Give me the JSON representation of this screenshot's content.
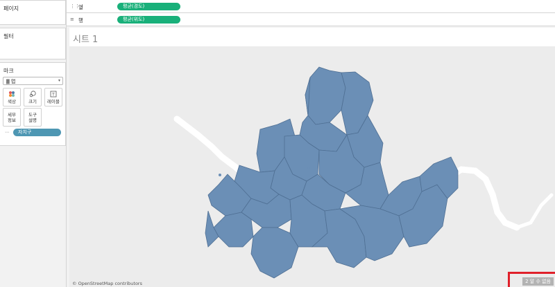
{
  "left_panel": {
    "pages_title": "페이지",
    "filters_title": "필터",
    "marks_title": "마크",
    "mark_type": "맵",
    "mark_buttons": {
      "color": "색상",
      "size": "크기",
      "label": "레이블",
      "detail": "세부\n정보",
      "tooltip": "도구\n설명"
    },
    "detail_field": "자치구"
  },
  "shelves": {
    "columns_label": "열",
    "columns_pill": "평균(경도)",
    "rows_label": "행",
    "rows_pill": "평균(위도)"
  },
  "sheet": {
    "title": "시트 1",
    "attribution": "© OpenStreetMap contributors",
    "nulls_indicator": "2 알 수 없음"
  },
  "colors": {
    "district_fill": "#6b8fb6",
    "district_stroke": "#4f6f93",
    "river": "#ffffff",
    "map_bg": "#ececec",
    "columns_pill": "#19b07a",
    "field_pill": "#4e97b3",
    "highlight": "#e0202a"
  }
}
